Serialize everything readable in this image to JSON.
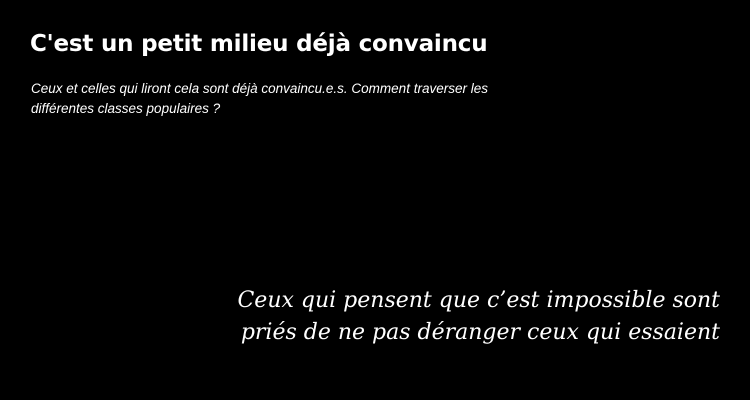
{
  "header": {
    "title": "C'est un petit milieu déjà convaincu",
    "subtitle_line1": "Ceux et celles qui liront cela sont déjà convaincu.e.s. Comment traverser les",
    "subtitle_line2": "différentes classes populaires ?"
  },
  "quote": {
    "line1": "Ceux qui pensent que c’est impossible sont",
    "line2": "priés de ne pas déranger ceux qui essaient"
  },
  "colors": {
    "background": "#000000",
    "text": "#ffffff"
  }
}
